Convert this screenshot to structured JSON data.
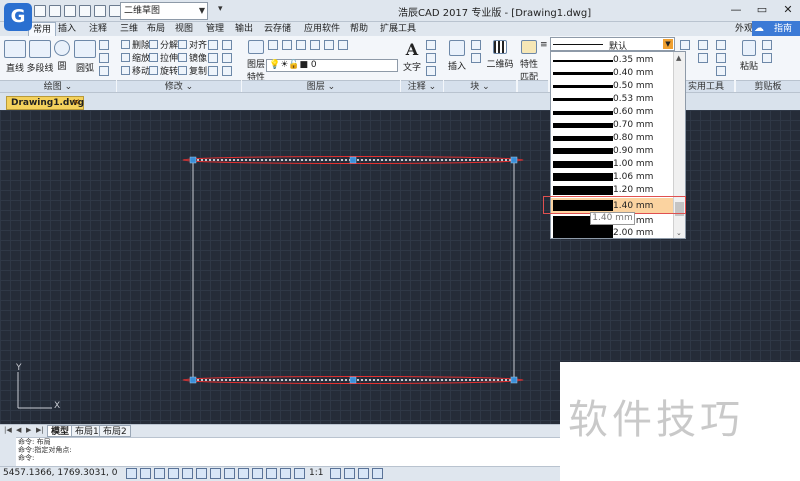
{
  "titlebar": {
    "logo": "G",
    "workspace": "二维草图",
    "title": "浩辰CAD 2017 专业版 - [Drawing1.dwg]",
    "minimize": "—",
    "restore": "▭",
    "close": "✕"
  },
  "ribbon_tabs": [
    "常用",
    "插入",
    "注释",
    "三维",
    "布局",
    "视图",
    "管理",
    "输出",
    "云存储",
    "应用软件",
    "帮助",
    "扩展工具"
  ],
  "ribbon_right": {
    "appearance": "外观",
    "assist": "指南"
  },
  "draw_panel": {
    "line": "直线",
    "polyline": "多段线",
    "circle": "圆",
    "arc": "圆弧",
    "title": "绘图"
  },
  "modify_panel": {
    "erase": "删除",
    "explode": "分解",
    "align": "对齐",
    "scale": "缩放",
    "stretch": "拉伸",
    "mirror": "镜像",
    "move": "移动",
    "rotate": "旋转",
    "copy": "复制",
    "title": "修改"
  },
  "layer_panel": {
    "layer_label": "图层",
    "properties_label": "特性",
    "current_layer": "0",
    "title": "图层"
  },
  "annot_panel": {
    "text": "文字",
    "title": "注释"
  },
  "block_panel": {
    "insert": "插入",
    "qrcode": "二维码",
    "title": "块"
  },
  "props_panel": {
    "match": "特性",
    "match2": "匹配"
  },
  "utils_panel": {
    "title": "实用工具"
  },
  "clipboard_panel": {
    "paste": "粘贴",
    "title": "剪贴板"
  },
  "lineweight": {
    "current": "默认",
    "options": [
      "0.35 mm",
      "0.40 mm",
      "0.50 mm",
      "0.53 mm",
      "0.60 mm",
      "0.70 mm",
      "0.80 mm",
      "0.90 mm",
      "1.00 mm",
      "1.06 mm",
      "1.20 mm",
      "1.40 mm",
      "1.58 mm",
      "2.00 mm"
    ],
    "selected": "1.40 mm",
    "tooltip": "1.40 mm"
  },
  "document_tab": {
    "name": "Drawing1.dwg",
    "close": "✕"
  },
  "layout_tabs": [
    "模型",
    "布局1",
    "布局2"
  ],
  "command": {
    "line1": "命令: 布局",
    "line2": "命令:指定对角点:",
    "line3": "命令:"
  },
  "status": {
    "coords": "5457.1366, 1769.3031, 0",
    "scale": "1:1"
  },
  "ucs": {
    "y": "Y",
    "x": "X"
  },
  "watermark": "软件技巧",
  "colors": {
    "canvas": "#252c38",
    "selection_red": "#e03030",
    "grip_blue": "#3a8fd8",
    "highlight": "#fbd3a0",
    "doc_tab": "#f4d15c"
  }
}
